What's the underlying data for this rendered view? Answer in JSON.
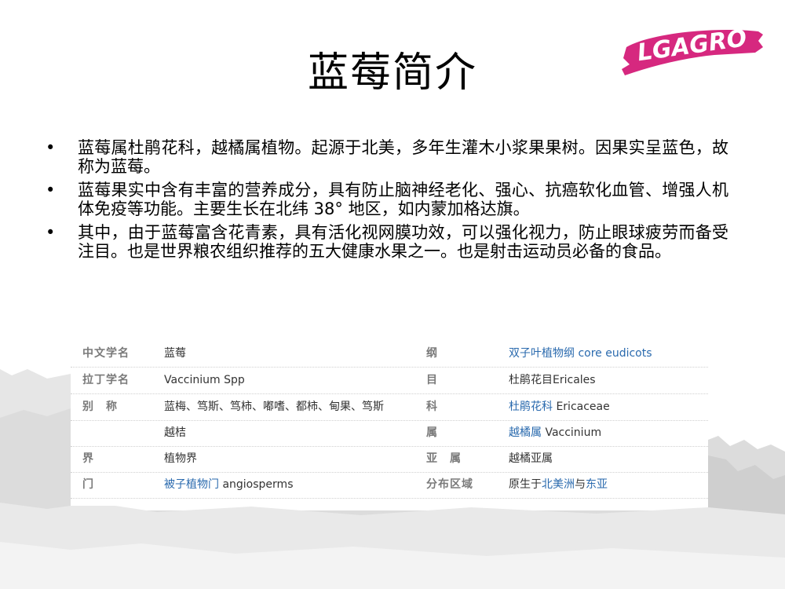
{
  "title": "蓝莓简介",
  "logo": {
    "text": "LGAGRO",
    "color": "#d6287f"
  },
  "bullets": [
    "蓝莓属杜鹃花科，越橘属植物。起源于北美，多年生灌木小浆果果树。因果实呈蓝色，故称为蓝莓。",
    "蓝莓果实中含有丰富的营养成分，具有防止脑神经老化、强心、抗癌软化血管、增强人机体免疫等功能。主要生长在北纬 38° 地区，如内蒙加格达旗。",
    "其中，由于蓝莓富含花青素，具有活化视网膜功效，可以强化视力，防止眼球疲劳而备受注目。也是世界粮农组织推荐的五大健康水果之一。也是射击运动员必备的食品。"
  ],
  "table": {
    "rows": [
      {
        "l1": "中文学名",
        "v1": "蓝莓",
        "l2": "纲",
        "v2": "双子叶植物纲 core eudicots"
      },
      {
        "l1": "拉丁学名",
        "v1": "Vaccinium Spp",
        "l2": "目",
        "v2": "杜鹃花目Ericales"
      },
      {
        "l1": "别　称",
        "v1": "蓝梅、笃斯、笃柿、嘟嗜、都柿、甸果、笃斯",
        "l2": "科",
        "v2a": "杜鹃花科",
        "v2b": "Ericaceae"
      },
      {
        "l1": "",
        "v1": "越桔",
        "l2": "属",
        "v2a": "越橘属",
        "v2b": "Vaccinium"
      },
      {
        "l1": "界",
        "v1": "植物界",
        "l2": "亚　属",
        "v2": "越橘亚属"
      },
      {
        "l1": "门",
        "v1a": "被子植物门",
        "v1b": "angiosperms",
        "l2": "分布区域",
        "v2a": "原生于",
        "v2b": "北美洲",
        "v2c": "与",
        "v2d": "东亚"
      }
    ]
  },
  "colors": {
    "link": "#2a6aae",
    "label": "#7a7a7a",
    "grunge": "#d9d9d9"
  }
}
